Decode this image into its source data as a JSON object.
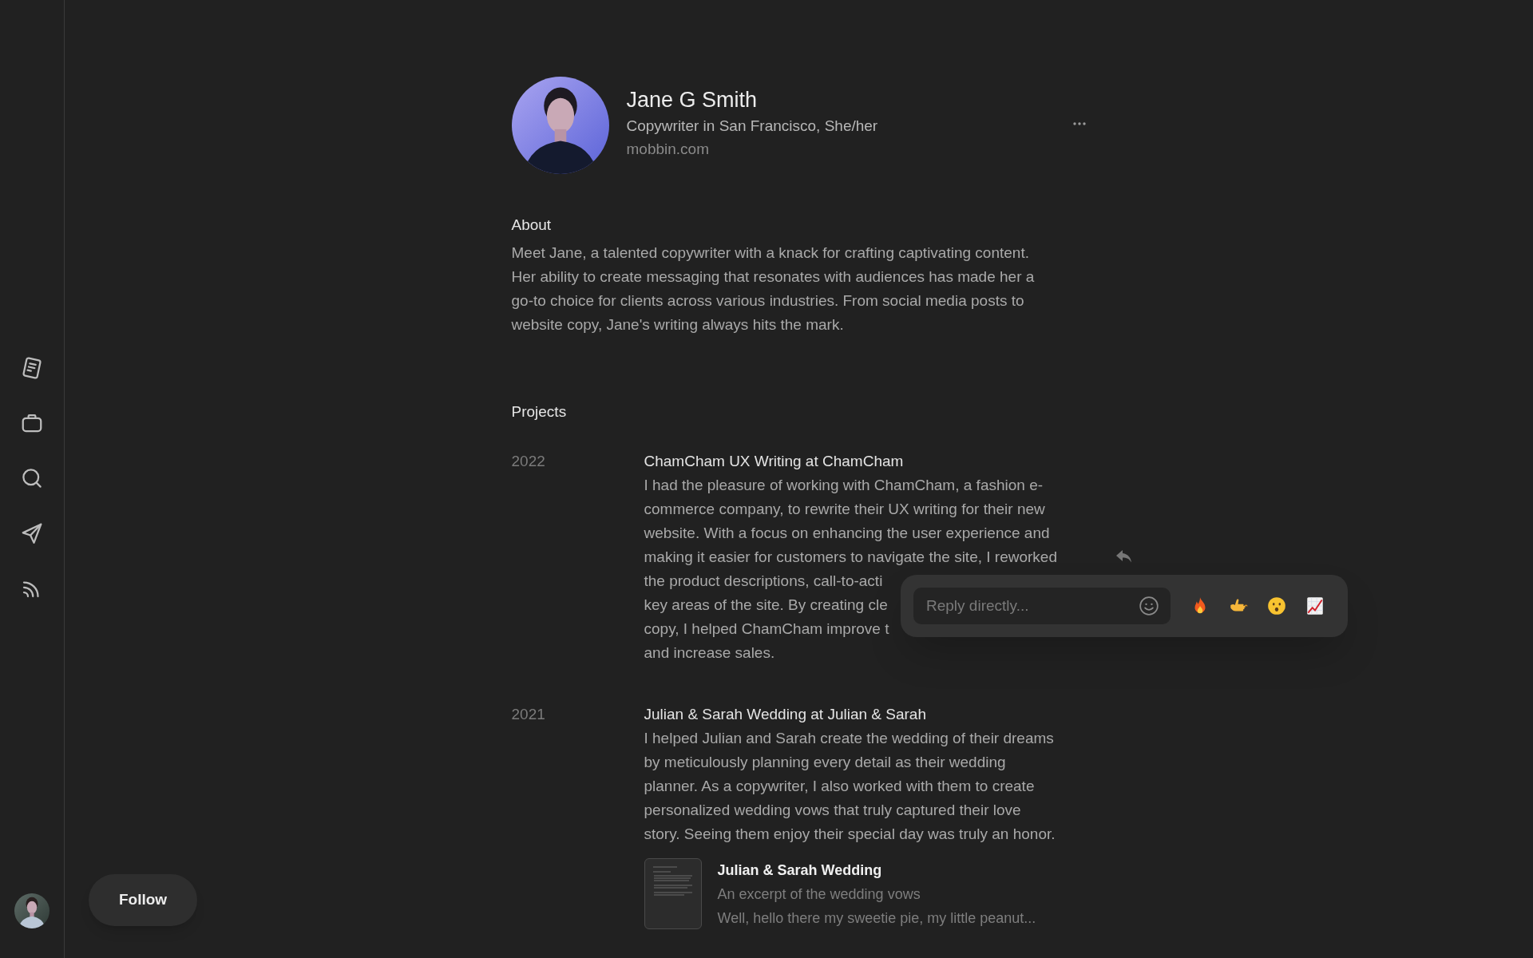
{
  "sidebar": {
    "nav": [
      {
        "kind": "notes"
      },
      {
        "kind": "briefcase"
      },
      {
        "kind": "search"
      },
      {
        "kind": "send"
      },
      {
        "kind": "feed"
      }
    ]
  },
  "profile": {
    "name": "Jane G Smith",
    "headline": "Copywriter in San Francisco, She/her",
    "website": "mobbin.com"
  },
  "about": {
    "heading": "About",
    "text": "Meet Jane, a talented copywriter with a knack for crafting captivating content.\nHer ability to create messaging that resonates with audiences has made her a\ngo-to choice for clients across various industries. From social media posts to\nwebsite copy, Jane's writing always hits the mark."
  },
  "projects": {
    "heading": "Projects",
    "items": [
      {
        "year": "2022",
        "title": "ChamCham UX Writing at ChamCham",
        "description": "I had the pleasure of working with ChamCham, a fashion e-\ncommerce company, to rewrite their UX writing for their new\nwebsite. With a focus on enhancing the user experience and\nmaking it easier for customers to navigate the site, I reworked\nthe product descriptions, call-to-acti\nkey areas of the site. By creating cle\ncopy, I helped ChamCham improve t\nand increase sales."
      },
      {
        "year": "2021",
        "title": "Julian & Sarah Wedding at Julian & Sarah",
        "description": "I helped Julian and Sarah create the wedding of their dreams\nby meticulously planning every detail as their wedding\nplanner. As a copywriter, I also worked with them to create\npersonalized wedding vows that truly captured their love\nstory. Seeing them enjoy their special day was truly an honor.",
        "attachment": {
          "title": "Julian & Sarah Wedding",
          "subtitle": "An excerpt of the wedding vows",
          "snippet": "Well, hello there my sweetie pie, my little peanut..."
        }
      }
    ]
  },
  "reply_popup": {
    "placeholder": "Reply directly...",
    "reactions": [
      {
        "kind": "fire"
      },
      {
        "kind": "hand"
      },
      {
        "kind": "surprised"
      },
      {
        "kind": "chart"
      }
    ]
  },
  "follow_button": "Follow"
}
